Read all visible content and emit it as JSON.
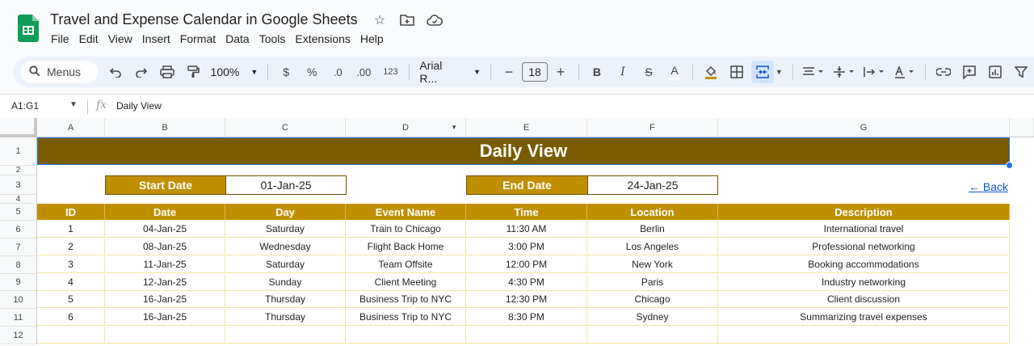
{
  "app": {
    "title": "Travel and Expense Calendar in Google Sheets",
    "menu": [
      "File",
      "Edit",
      "View",
      "Insert",
      "Format",
      "Data",
      "Tools",
      "Extensions",
      "Help"
    ]
  },
  "toolbar": {
    "search_label": "Menus",
    "zoom": "100%",
    "currency": "$",
    "percent": "%",
    "decrease_decimal": ".0",
    "increase_decimal": ".00",
    "number_format": "123",
    "font": "Arial R...",
    "font_size": "18",
    "minus": "−",
    "plus": "+",
    "bold": "B",
    "italic": "I",
    "strike": "S",
    "text_color": "A"
  },
  "formula_bar": {
    "name_box": "A1:G1",
    "fx": "fx",
    "content": "Daily View"
  },
  "columns": [
    "A",
    "B",
    "C",
    "D",
    "E",
    "F",
    "G"
  ],
  "rows": [
    "1",
    "2",
    "3",
    "4",
    "5",
    "6",
    "7",
    "8",
    "9",
    "10",
    "11",
    "12"
  ],
  "sheet": {
    "banner": "Daily View",
    "start_label": "Start Date",
    "start_value": "01-Jan-25",
    "end_label": "End Date",
    "end_value": "24-Jan-25",
    "back_link": "← Back",
    "headers": [
      "ID",
      "Date",
      "Day",
      "Event Name",
      "Time",
      "Location",
      "Description"
    ],
    "data": [
      [
        "1",
        "04-Jan-25",
        "Saturday",
        "Train to Chicago",
        "11:30 AM",
        "Berlin",
        "International travel"
      ],
      [
        "2",
        "08-Jan-25",
        "Wednesday",
        "Flight Back Home",
        "3:00 PM",
        "Los Angeles",
        "Professional networking"
      ],
      [
        "3",
        "11-Jan-25",
        "Saturday",
        "Team Offsite",
        "12:00 PM",
        "New York",
        "Booking accommodations"
      ],
      [
        "4",
        "12-Jan-25",
        "Sunday",
        "Client Meeting",
        "4:30 PM",
        "Paris",
        "Industry networking"
      ],
      [
        "5",
        "16-Jan-25",
        "Thursday",
        "Business Trip to NYC",
        "12:30 PM",
        "Chicago",
        "Client discussion"
      ],
      [
        "6",
        "16-Jan-25",
        "Thursday",
        "Business Trip to NYC",
        "8:30 PM",
        "Sydney",
        "Summarizing travel expenses"
      ]
    ]
  },
  "colors": {
    "banner": "#7a5b00",
    "header_gold": "#c08f00",
    "link": "#1155cc",
    "selection": "#1a73e8"
  }
}
